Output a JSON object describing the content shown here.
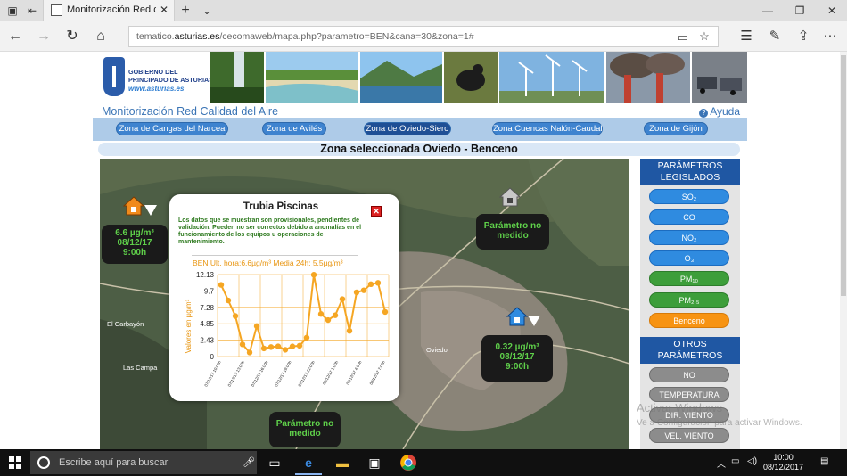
{
  "browser": {
    "tab_title": "Monitorización Red de c",
    "url_prefix": "tematico.",
    "url_domain": "asturias.es",
    "url_rest": "/cecomaweb/mapa.php?parametro=BEN&cana=30&zona=1#"
  },
  "site": {
    "logo_line1": "GOBIERNO DEL",
    "logo_line2": "PRINCIPADO DE ASTURIAS",
    "logo_url": "www.asturias.es",
    "title": "Monitorización Red Calidad del Aire",
    "help": "Ayuda"
  },
  "zones": [
    "Zona de Cangas del Narcea",
    "Zona de Avilés",
    "Zona de Oviedo-Siero",
    "Zona Cuencas Nalón-Caudal",
    "Zona de Gijón"
  ],
  "selected_zone_heading": "Zona seleccionada Oviedo - Benceno",
  "map": {
    "labels": {
      "carbayon": "El Carbayón",
      "campa": "Las Campa",
      "oviedo": "Oviedo"
    },
    "stations": [
      {
        "line1": "6.6 µg/m³",
        "line2": "08/12/17",
        "line3": "9:00h"
      },
      {
        "line1": "Parámetro no",
        "line2": "medido"
      },
      {
        "line1": "0.32 µg/m³",
        "line2": "08/12/17",
        "line3": "9:00h"
      },
      {
        "line1": "Parámetro no",
        "line2": "medido"
      }
    ]
  },
  "popup": {
    "title": "Trubia Piscinas",
    "note": "Los datos que se muestran son provisionales, pendientes de validación. Pueden no ser correctos debido a anomalías en el funcionamiento de los equipos u operaciones de mantenimiento.",
    "summary": "BEN Ult. hora:6.6µg/m³ Media 24h: 5.5µg/m³"
  },
  "chart_data": {
    "type": "line",
    "ylabel": "Valores en µg/m³",
    "yticks": [
      "0",
      "2.43",
      "4.85",
      "7.28",
      "9.7",
      "12.13"
    ],
    "ylim": [
      0,
      12.13
    ],
    "xticks": [
      "07/12/17 10:00h",
      "07/12/17 13:00h",
      "07/12/17 16:00h",
      "07/12/17 19:00h",
      "07/12/17 22:00h",
      "08/12/17 1:00h",
      "08/12/17 4:00h",
      "08/12/17 7:00h"
    ],
    "color": "#f5a623",
    "values": [
      10.6,
      8.3,
      6.0,
      1.8,
      0.6,
      4.5,
      1.2,
      1.4,
      1.5,
      1.0,
      1.5,
      1.6,
      2.8,
      12.1,
      6.3,
      5.4,
      6.1,
      8.5,
      3.8,
      9.5,
      9.8,
      10.7,
      10.9,
      6.6
    ]
  },
  "sidebar": {
    "legislados_title": "PARÁMETROS LEGISLADOS",
    "legislados": [
      {
        "label": "SO₂",
        "color": "blue"
      },
      {
        "label": "CO",
        "color": "blue"
      },
      {
        "label": "NO₂",
        "color": "blue"
      },
      {
        "label": "O₃",
        "color": "blue"
      },
      {
        "label": "PM₁₀",
        "color": "green"
      },
      {
        "label": "PM₂.₅",
        "color": "green"
      },
      {
        "label": "Benceno",
        "color": "orange"
      }
    ],
    "otros_title": "OTROS PARÁMETROS",
    "otros": [
      "NO",
      "TEMPERATURA",
      "DIR. VIENTO",
      "VEL. VIENTO"
    ]
  },
  "watermark": {
    "line1": "Activar Windows",
    "line2": "Ve a Configuración para activar Windows."
  },
  "taskbar": {
    "search_placeholder": "Escribe aquí para buscar",
    "time": "10:00",
    "date": "08/12/2017"
  }
}
